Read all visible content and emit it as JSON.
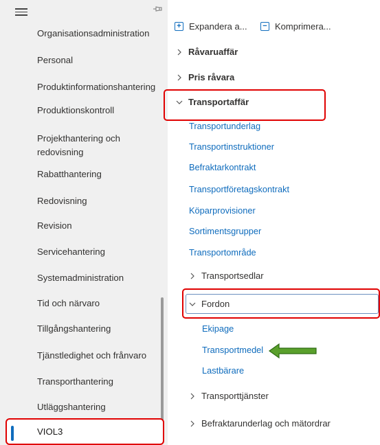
{
  "nav": {
    "items": [
      {
        "label": "Organisationsadministration"
      },
      {
        "label": "Personal"
      },
      {
        "label": "Produktinformationshantering"
      },
      {
        "label": "Produktionskontroll"
      },
      {
        "label": "Projekthantering och\nredovisning"
      },
      {
        "label": "Rabatthantering"
      },
      {
        "label": "Redovisning"
      },
      {
        "label": "Revision"
      },
      {
        "label": "Servicehantering"
      },
      {
        "label": "Systemadministration"
      },
      {
        "label": "Tid och närvaro"
      },
      {
        "label": "Tillgångshantering"
      },
      {
        "label": "Tjänstledighet och frånvaro"
      },
      {
        "label": "Transporthantering"
      },
      {
        "label": "Utläggshantering"
      }
    ],
    "active_item": "VIOL3"
  },
  "toolbar": {
    "expand_label": "Expandera a...",
    "collapse_label": "Komprimera..."
  },
  "tree": {
    "groups": [
      {
        "label": "Råvaruaffär",
        "expanded": false
      },
      {
        "label": "Pris råvara",
        "expanded": false
      },
      {
        "label": "Transportaffär",
        "expanded": true
      }
    ],
    "transport_links": [
      "Transportunderlag",
      "Transportinstruktioner",
      "Befraktarkontrakt",
      "Transportföretagskontrakt",
      "Köparprovisioner",
      "Sortimentsgrupper",
      "Transportområde"
    ],
    "subgroups": {
      "transportsedlar": "Transportsedlar",
      "fordon": "Fordon",
      "transporttjanster": "Transporttjänster",
      "befraktarunderlag": "Befraktarunderlag och mätordrar"
    },
    "fordon_links": [
      "Ekipage",
      "Transportmedel",
      "Lastbärare"
    ]
  },
  "colors": {
    "accent": "#0f6cbd",
    "highlight_box": "#e00000",
    "arrow": "#5aa02c"
  },
  "icons": {
    "menu": "hamburger-icon",
    "pin": "pin-icon",
    "expand": "expand-all-icon",
    "collapse": "collapse-all-icon",
    "chevron_right": "chevron-right-icon",
    "chevron_down": "chevron-down-icon",
    "arrow": "green-arrow-icon"
  }
}
